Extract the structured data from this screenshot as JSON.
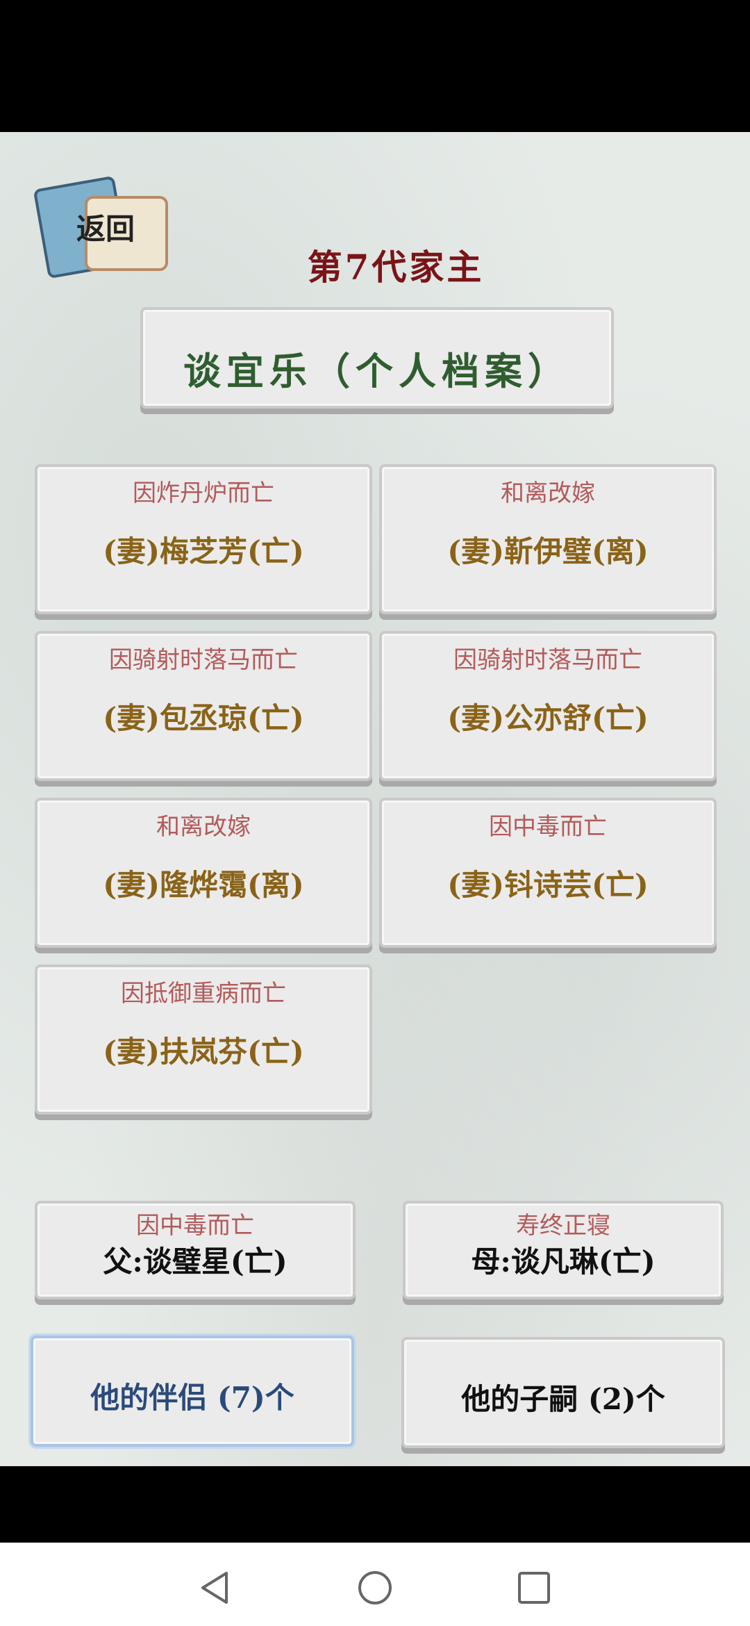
{
  "header": {
    "back_label": "返回",
    "generation_title": "第7代家主",
    "profile_title": "谈宜乐（个人档案）"
  },
  "spouses": [
    {
      "cause": "因炸丹炉而亡",
      "name": "(妻)梅芝芳(亡)"
    },
    {
      "cause": "和离改嫁",
      "name": "(妻)靳伊璧(离)"
    },
    {
      "cause": "因骑射时落马而亡",
      "name": "(妻)包丞琼(亡)"
    },
    {
      "cause": "因骑射时落马而亡",
      "name": "(妻)公亦舒(亡)"
    },
    {
      "cause": "和离改嫁",
      "name": "(妻)隆烨霭(离)"
    },
    {
      "cause": "因中毒而亡",
      "name": "(妻)钭诗芸(亡)"
    },
    {
      "cause": "因抵御重病而亡",
      "name": "(妻)扶岚芬(亡)"
    }
  ],
  "parents": {
    "father": {
      "cause": "因中毒而亡",
      "name": "父:谈璧星(亡)"
    },
    "mother": {
      "cause": "寿终正寝",
      "name": "母:谈凡琳(亡)"
    }
  },
  "tabs": {
    "partners": "他的伴侣 (7)个",
    "children": "他的子嗣 (2)个"
  },
  "colors": {
    "title_red": "#7a1418",
    "profile_green": "#2f5d2f",
    "spouse_gold": "#8a6318",
    "cause_red": "#b35a5a",
    "active_tab_blue": "#2b4a7a"
  }
}
